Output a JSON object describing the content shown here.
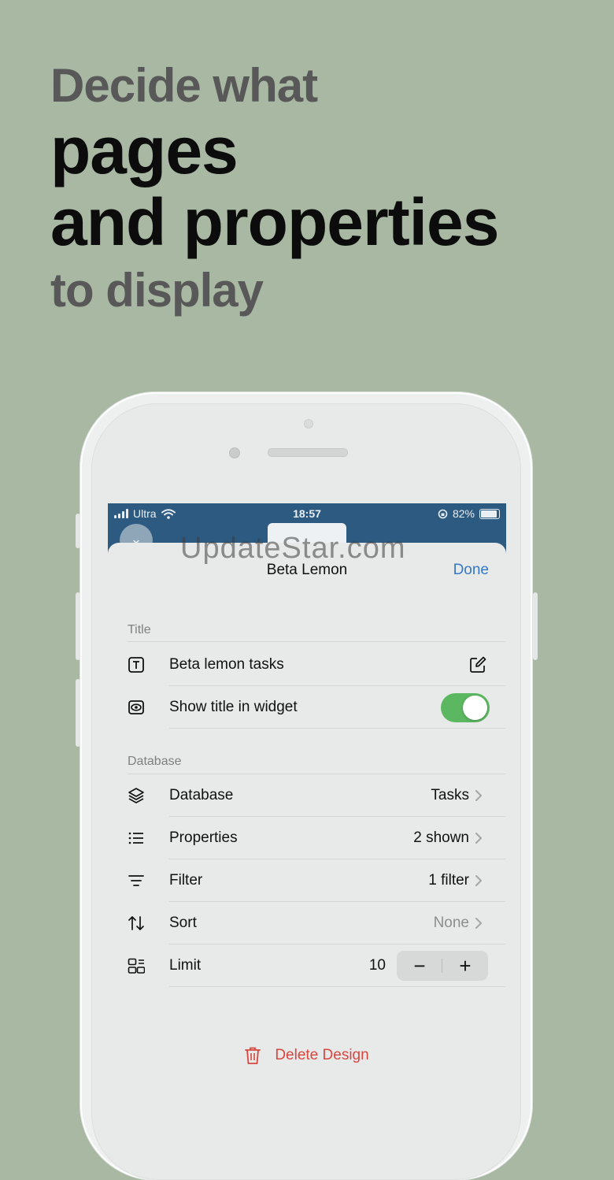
{
  "headline": {
    "line1": "Decide what",
    "line2": "pages",
    "line3": "and properties",
    "line4": "to display"
  },
  "status_bar": {
    "carrier": "Ultra",
    "time": "18:57",
    "battery": "82%"
  },
  "watermark": "UpdateStar.com",
  "sheet": {
    "title": "Beta Lemon",
    "done_label": "Done"
  },
  "title_section": {
    "label": "Title",
    "title_value": "Beta lemon tasks",
    "show_title_label": "Show title in widget",
    "show_title_enabled": true
  },
  "database_section": {
    "label": "Database",
    "rows": [
      {
        "icon": "layers-icon",
        "label": "Database",
        "value": "Tasks"
      },
      {
        "icon": "list-icon",
        "label": "Properties",
        "value": "2 shown"
      },
      {
        "icon": "filter-icon",
        "label": "Filter",
        "value": "1 filter"
      },
      {
        "icon": "sort-icon",
        "label": "Sort",
        "value": "None"
      }
    ],
    "limit": {
      "label": "Limit",
      "value": "10",
      "decrement": "−",
      "increment": "+"
    }
  },
  "delete_label": "Delete Design",
  "colors": {
    "background": "#a8b8a3",
    "accent": "#3478c6",
    "toggle_on": "#5cb860",
    "destructive": "#d9463e"
  }
}
